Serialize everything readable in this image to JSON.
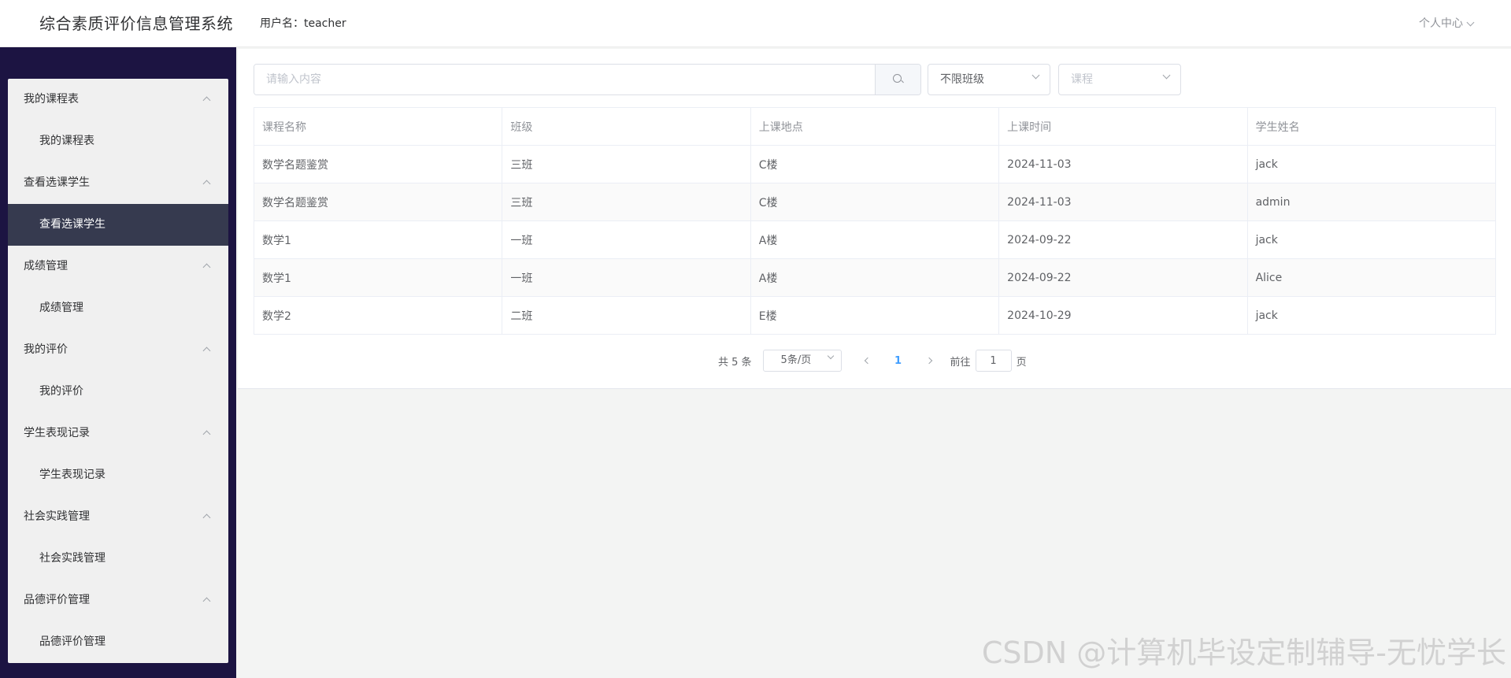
{
  "header": {
    "app_title": "综合素质评价信息管理系统",
    "username_label": "用户名：teacher",
    "user_center_label": "个人中心"
  },
  "sidebar": {
    "groups": [
      {
        "label": "我的课程表",
        "items": [
          {
            "label": "我的课程表",
            "active": false
          }
        ]
      },
      {
        "label": "查看选课学生",
        "items": [
          {
            "label": "查看选课学生",
            "active": true
          }
        ]
      },
      {
        "label": "成绩管理",
        "items": [
          {
            "label": "成绩管理",
            "active": false
          }
        ]
      },
      {
        "label": "我的评价",
        "items": [
          {
            "label": "我的评价",
            "active": false
          }
        ]
      },
      {
        "label": "学生表现记录",
        "items": [
          {
            "label": "学生表现记录",
            "active": false
          }
        ]
      },
      {
        "label": "社会实践管理",
        "items": [
          {
            "label": "社会实践管理",
            "active": false
          }
        ]
      },
      {
        "label": "品德评价管理",
        "items": [
          {
            "label": "品德评价管理",
            "active": false
          }
        ]
      }
    ]
  },
  "filters": {
    "search_placeholder": "请输入内容",
    "search_value": "",
    "class_select_value": "不限班级",
    "course_select_placeholder": "课程"
  },
  "table": {
    "columns": [
      "课程名称",
      "班级",
      "上课地点",
      "上课时间",
      "学生姓名"
    ],
    "rows": [
      [
        "数学名题鉴赏",
        "三班",
        "C楼",
        "2024-11-03",
        "jack"
      ],
      [
        "数学名题鉴赏",
        "三班",
        "C楼",
        "2024-11-03",
        "admin"
      ],
      [
        "数学1",
        "一班",
        "A楼",
        "2024-09-22",
        "jack"
      ],
      [
        "数学1",
        "一班",
        "A楼",
        "2024-09-22",
        "Alice"
      ],
      [
        "数学2",
        "二班",
        "E楼",
        "2024-10-29",
        "jack"
      ]
    ]
  },
  "pagination": {
    "total_label": "共 5 条",
    "page_size_label": "5条/页",
    "current_page": "1",
    "goto_prefix": "前往",
    "goto_value": "1",
    "goto_suffix": "页"
  },
  "watermark": "CSDN @计算机毕设定制辅导-无忧学长",
  "colors": {
    "sidebar_bg": "#1c1442",
    "active_item_bg": "#363a4f",
    "accent": "#409eff"
  }
}
